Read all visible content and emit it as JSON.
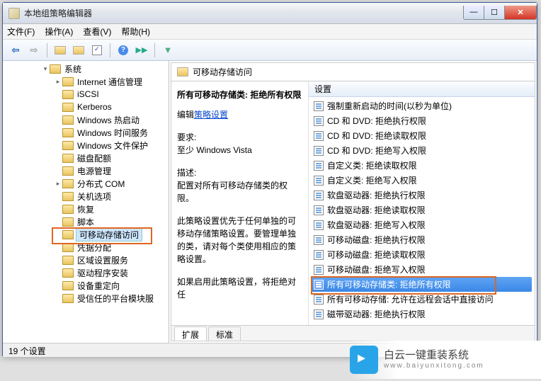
{
  "window": {
    "title": "本地组策略编辑器"
  },
  "menu": {
    "file": "文件(F)",
    "action": "操作(A)",
    "view": "查看(V)",
    "help": "帮助(H)"
  },
  "tree": [
    {
      "lvl": 3,
      "expand": "▾",
      "label": "系统"
    },
    {
      "lvl": 4,
      "expand": "▸",
      "label": "Internet 通信管理"
    },
    {
      "lvl": 4,
      "expand": "",
      "label": "iSCSI"
    },
    {
      "lvl": 4,
      "expand": "",
      "label": "Kerberos"
    },
    {
      "lvl": 4,
      "expand": "",
      "label": "Windows 热启动"
    },
    {
      "lvl": 4,
      "expand": "",
      "label": "Windows 时间服务"
    },
    {
      "lvl": 4,
      "expand": "",
      "label": "Windows 文件保护"
    },
    {
      "lvl": 4,
      "expand": "",
      "label": "磁盘配额"
    },
    {
      "lvl": 4,
      "expand": "",
      "label": "电源管理"
    },
    {
      "lvl": 4,
      "expand": "▸",
      "label": "分布式 COM"
    },
    {
      "lvl": 4,
      "expand": "",
      "label": "关机选项"
    },
    {
      "lvl": 4,
      "expand": "",
      "label": "恢复"
    },
    {
      "lvl": 4,
      "expand": "",
      "label": "脚本"
    },
    {
      "lvl": 4,
      "expand": "",
      "label": "可移动存储访问",
      "selected": true,
      "boxed": true
    },
    {
      "lvl": 4,
      "expand": "",
      "label": "凭据分配"
    },
    {
      "lvl": 4,
      "expand": "",
      "label": "区域设置服务"
    },
    {
      "lvl": 4,
      "expand": "",
      "label": "驱动程序安装"
    },
    {
      "lvl": 4,
      "expand": "",
      "label": "设备重定向"
    },
    {
      "lvl": 4,
      "expand": "",
      "label": "受信任的平台模块服"
    }
  ],
  "path_header": "可移动存储访问",
  "detail": {
    "title": "所有可移动存储类: 拒绝所有权限",
    "edit_prefix": "编辑",
    "edit_link": "策略设置",
    "req_label": "要求:",
    "req_value": "至少 Windows Vista",
    "desc_label": "描述:",
    "desc_p1": "配置对所有可移动存储类的权限。",
    "desc_p2": "此策略设置优先于任何单独的可移动存储策略设置。要管理单独的类，请对每个类使用相应的策略设置。",
    "desc_p3": "如果启用此策略设置，将拒绝对任"
  },
  "list": {
    "header": "设置",
    "items": [
      {
        "label": "强制重新启动的时间(以秒为单位)"
      },
      {
        "label": "CD 和 DVD: 拒绝执行权限"
      },
      {
        "label": "CD 和 DVD: 拒绝读取权限"
      },
      {
        "label": "CD 和 DVD: 拒绝写入权限"
      },
      {
        "label": "自定义类: 拒绝读取权限"
      },
      {
        "label": "自定义类: 拒绝写入权限"
      },
      {
        "label": "软盘驱动器: 拒绝执行权限"
      },
      {
        "label": "软盘驱动器: 拒绝读取权限"
      },
      {
        "label": "软盘驱动器: 拒绝写入权限"
      },
      {
        "label": "可移动磁盘: 拒绝执行权限"
      },
      {
        "label": "可移动磁盘: 拒绝读取权限"
      },
      {
        "label": "可移动磁盘: 拒绝写入权限"
      },
      {
        "label": "所有可移动存储类: 拒绝所有权限",
        "selected": true,
        "boxed": true
      },
      {
        "label": "所有可移动存储: 允许在远程会话中直接访问"
      },
      {
        "label": "磁带驱动器: 拒绝执行权限"
      }
    ]
  },
  "tabs": {
    "extended": "扩展",
    "standard": "标准"
  },
  "status": "19 个设置",
  "watermark": {
    "line1": "白云一键重装系统",
    "line2": "www.baiyunxitong.com"
  }
}
